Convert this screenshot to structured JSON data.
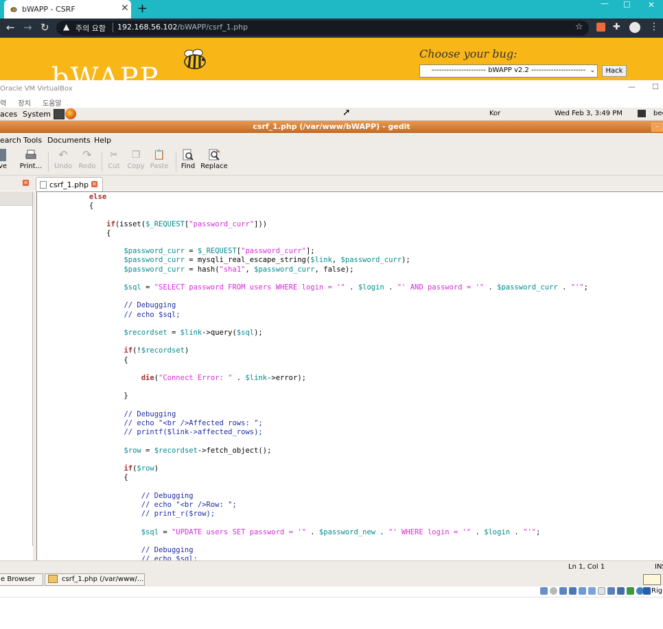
{
  "browser": {
    "tab_title": "bWAPP - CSRF",
    "tab_close": "✕",
    "new_tab": "+",
    "win_min": "—",
    "win_max": "☐",
    "win_close": "✕",
    "security_label": "주의 요함",
    "url_host": "192.168.56.102",
    "url_path": "/bWAPP/csrf_1.php",
    "icons": [
      "back-icon",
      "forward-icon",
      "reload-icon",
      "warning-icon",
      "star-icon",
      "extension-icon",
      "puzzle-icon",
      "profile-icon",
      "menu-icon"
    ]
  },
  "bwapp": {
    "logo": "bWAPP",
    "choose_label": "Choose your bug:",
    "selected_bug": "---------------------- bWAPP v2.2 ----------------------",
    "hack_button": "Hack"
  },
  "virtualbox": {
    "title": "Oracle VM VirtualBox",
    "min": "—",
    "max": "☐",
    "menu": [
      "력",
      "장치",
      "도움말"
    ]
  },
  "desktop_panel": {
    "places": "aces",
    "system": "System",
    "keyboard": "Kor",
    "clock": "Wed Feb  3,  3:49 PM",
    "user": "bee"
  },
  "gedit": {
    "title": "csrf_1.php (/var/www/bWAPP) - gedit",
    "menu": [
      "earch",
      "Tools",
      "Documents",
      "Help"
    ],
    "toolbar": [
      {
        "label": "ve",
        "enabled": true
      },
      {
        "label": "Print...",
        "enabled": true
      },
      {
        "label": "Undo",
        "enabled": false
      },
      {
        "label": "Redo",
        "enabled": false
      },
      {
        "label": "Cut",
        "enabled": false
      },
      {
        "label": "Copy",
        "enabled": false
      },
      {
        "label": "Paste",
        "enabled": false
      },
      {
        "label": "Find",
        "enabled": true
      },
      {
        "label": "Replace",
        "enabled": true
      }
    ],
    "tab_label": "csrf_1.php",
    "status": "Ln 1, Col 1",
    "ins": "INS"
  },
  "code_lines": [
    "            else",
    "            {",
    "",
    "                if(isset($_REQUEST[\"password_curr\"]))",
    "                {",
    "",
    "                    $password_curr = $_REQUEST[\"password_curr\"];",
    "                    $password_curr = mysqli_real_escape_string($link, $password_curr);",
    "                    $password_curr = hash(\"sha1\", $password_curr, false);",
    "",
    "                    $sql = \"SELECT password FROM users WHERE login = '\" . $login . \"' AND password = '\" . $password_curr . \"'\";",
    "",
    "                    // Debugging",
    "                    // echo $sql;",
    "",
    "                    $recordset = $link->query($sql);",
    "",
    "                    if(!$recordset)",
    "                    {",
    "",
    "                        die(\"Connect Error: \" . $link->error);",
    "",
    "                    }",
    "",
    "                    // Debugging",
    "                    // echo \"<br />Affected rows: \";",
    "                    // printf($link->affected_rows);",
    "",
    "                    $row = $recordset->fetch_object();",
    "",
    "                    if($row)",
    "                    {",
    "",
    "                        // Debugging",
    "                        // echo \"<br />Row: \";",
    "                        // print_r($row);",
    "",
    "                        $sql = \"UPDATE users SET password = '\" . $password_new . \"' WHERE login = '\" . $login . \"'\";",
    "",
    "                        // Debugging",
    "                        // echo $sql;"
  ],
  "taskbar": {
    "items": [
      "e Browser",
      "csrf_1.php (/var/www/..."
    ],
    "tray_label": "Righ"
  },
  "colors": {
    "chrome_tabstrip": "#1fb9c6",
    "chrome_toolbar": "#26303a",
    "bwapp_header": "#f9b617",
    "gedit_title": "#d27a30",
    "variable": "#008a8c",
    "string": "#d92ad9",
    "keyword": "#a52a2a",
    "comment": "#1d2aa6"
  }
}
